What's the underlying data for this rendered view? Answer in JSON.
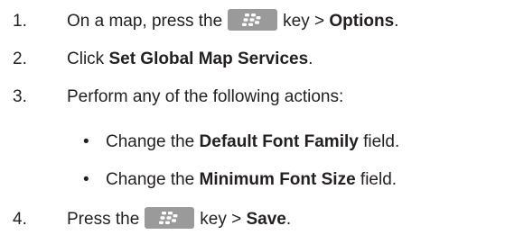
{
  "steps": [
    {
      "number": "1.",
      "before_key": "On a map, press the",
      "key_icon": "blackberry-menu-key-icon",
      "after_key": "key >",
      "bold": "Options",
      "end": "."
    },
    {
      "number": "2.",
      "before": "Click",
      "bold": "Set Global Map Services",
      "end": "."
    },
    {
      "number": "3.",
      "text": "Perform any of the following actions:"
    },
    {
      "number": "4.",
      "before_key": "Press the",
      "key_icon": "blackberry-menu-key-icon",
      "after_key": "key >",
      "bold": "Save",
      "end": "."
    }
  ],
  "actions": [
    {
      "bullet": "•",
      "before": "Change the",
      "bold": "Default Font Family",
      "after": "field."
    },
    {
      "bullet": "•",
      "before": "Change the",
      "bold": "Minimum Font Size",
      "after": "field."
    }
  ],
  "colors": {
    "text": "#231f20",
    "key_background": "#9a9a9a",
    "key_symbol": "#ffffff"
  }
}
